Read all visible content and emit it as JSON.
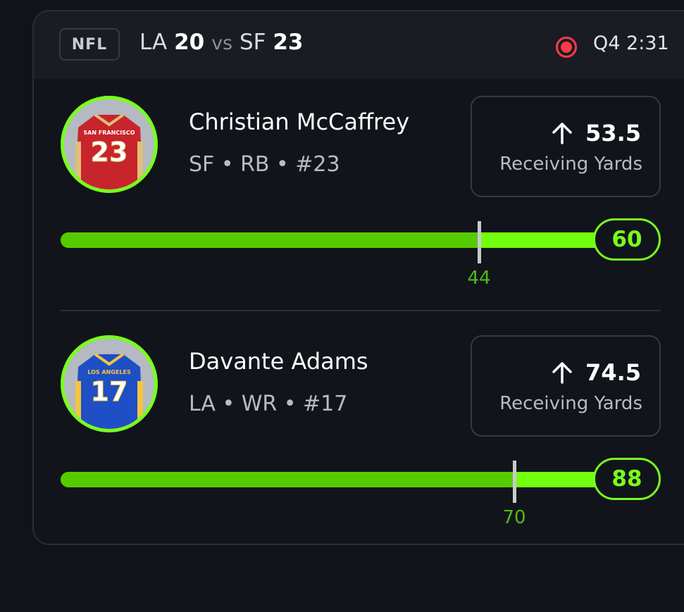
{
  "header": {
    "league": "NFL",
    "away_team": "LA",
    "away_score": "20",
    "vs": "vs",
    "home_team": "SF",
    "home_score": "23",
    "status_icon": "live-record-icon",
    "clock": "Q4 2:31",
    "live_color": "#ff3b47"
  },
  "players": [
    {
      "name": "Christian McCaffrey",
      "meta": "SF • RB • #23",
      "jersey_team": "SAN FRANCISCO",
      "jersey_number": "23",
      "jersey_color": "#c8242b",
      "direction_icon": "arrow-up-icon",
      "line": "53.5",
      "stat": "Receiving Yards",
      "current": "60",
      "marker": "44",
      "current_value": 60,
      "marker_value": 44
    },
    {
      "name": "Davante Adams",
      "meta": "LA • WR • #17",
      "jersey_team": "LOS ANGELES",
      "jersey_number": "17",
      "jersey_color": "#1f4fc4",
      "direction_icon": "arrow-up-icon",
      "line": "74.5",
      "stat": "Receiving Yards",
      "current": "88",
      "marker": "70",
      "current_value": 88,
      "marker_value": 70
    }
  ],
  "colors": {
    "accent": "#78ff1e",
    "bar_fill": "#55cc00",
    "background": "#11131a"
  }
}
